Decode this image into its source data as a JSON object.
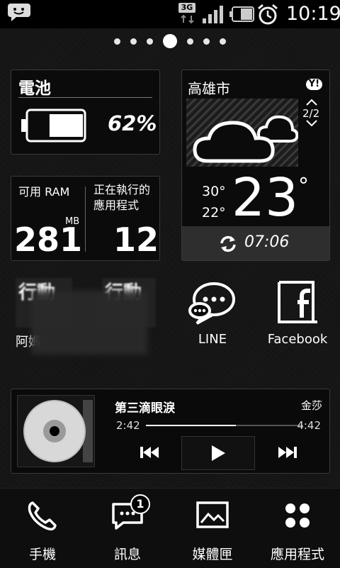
{
  "status_bar": {
    "network_type": "3G",
    "time": "10:19",
    "icons": [
      "message-icon",
      "network-3g-icon",
      "signal-icon",
      "battery-icon",
      "alarm-icon"
    ]
  },
  "pager": {
    "count": 7,
    "active_index": 3
  },
  "battery_widget": {
    "title": "電池",
    "percent": "62%",
    "level_fraction": 0.62
  },
  "ram_widget": {
    "available_label": "可用 RAM",
    "available_value": "281",
    "available_unit": "MB",
    "running_label": "正在執行的應用程式",
    "running_value": "12"
  },
  "weather_widget": {
    "city": "高雄市",
    "provider_badge": "Y!",
    "page_indicator": "2/2",
    "high": "30°",
    "low": "22°",
    "current_temp": "23",
    "degree_symbol": "°",
    "updated_time": "07:06",
    "condition_icon": "cloudy-icon"
  },
  "apps": [
    {
      "label": "阿媽",
      "name": "blurred-app-1",
      "icon_text": "行動"
    },
    {
      "label": "",
      "name": "blurred-app-2",
      "icon_text": "行動"
    },
    {
      "label": "LINE",
      "name": "line-app"
    },
    {
      "label": "Facebook",
      "name": "facebook-app"
    }
  ],
  "music_widget": {
    "title": "第三滴眼淚",
    "artist": "金莎",
    "elapsed": "2:42",
    "duration": "4:42",
    "progress_fraction": 0.57
  },
  "dock": [
    {
      "label": "手機",
      "icon": "phone-icon"
    },
    {
      "label": "訊息",
      "icon": "message-icon",
      "badge": "1"
    },
    {
      "label": "媒體匣",
      "icon": "gallery-icon"
    },
    {
      "label": "應用程式",
      "icon": "apps-grid-icon"
    }
  ]
}
